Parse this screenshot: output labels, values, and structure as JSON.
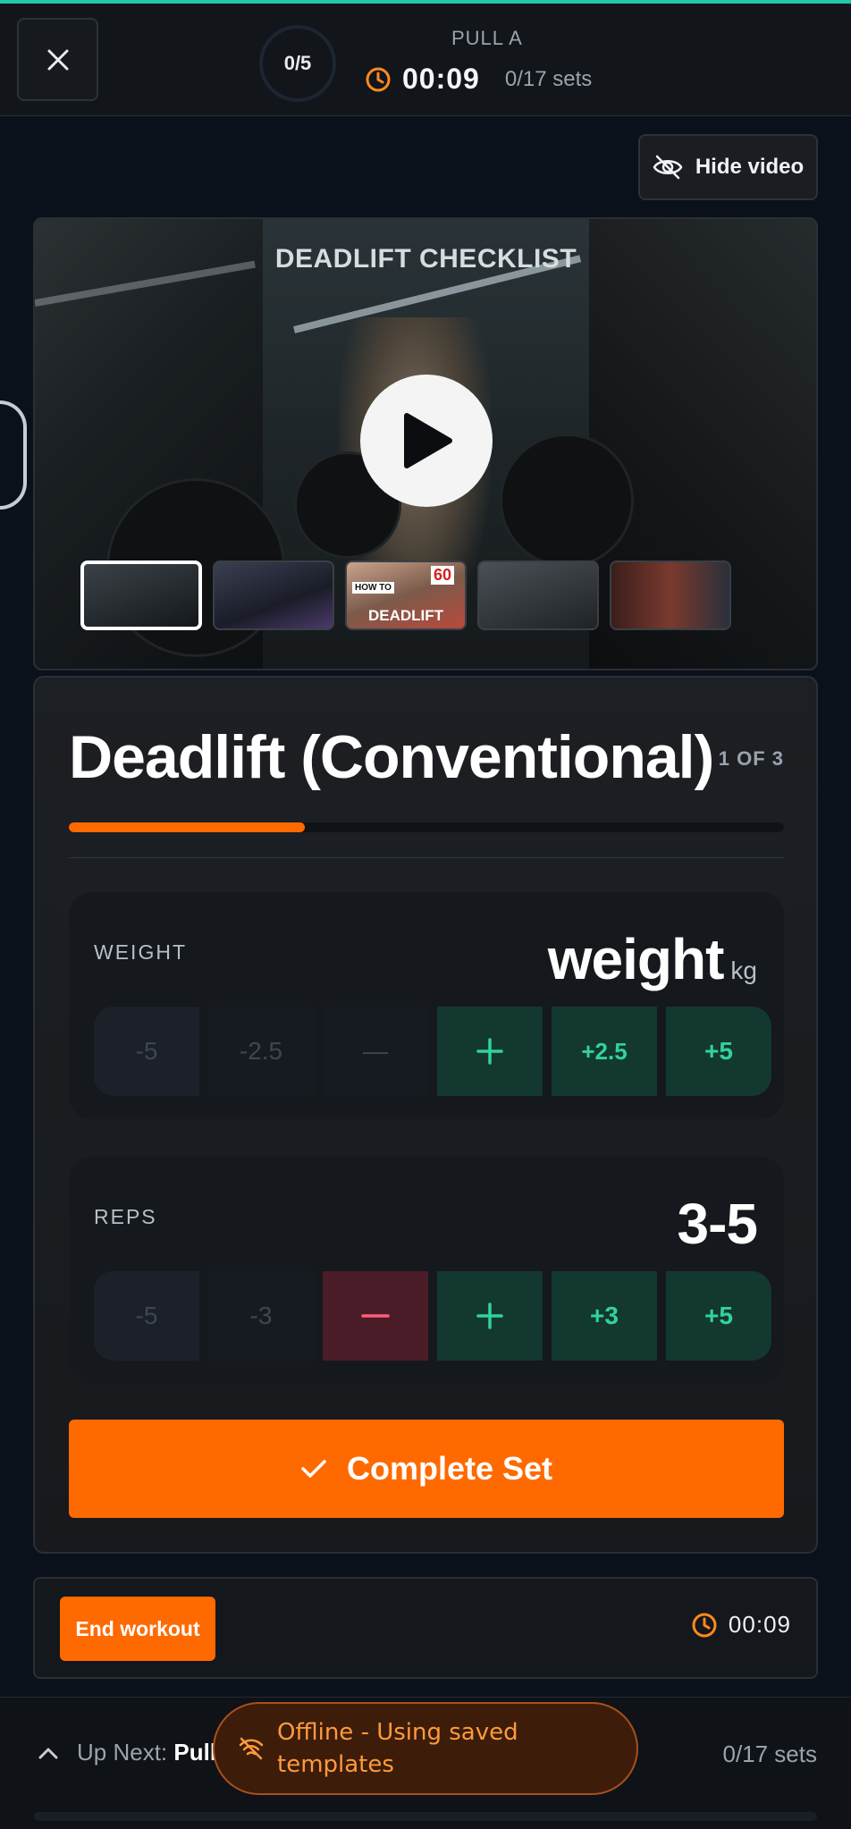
{
  "header": {
    "progress_text": "0/5",
    "workout_name": "PULL A",
    "timer": "00:09",
    "sets_progress": "0/17 sets"
  },
  "video": {
    "hide_label": "Hide video",
    "title": "DEADLIFT CHECKLIST",
    "thumbnails": [
      {
        "caption": ""
      },
      {
        "caption": ""
      },
      {
        "caption": "DEADLIFT",
        "badge": "60",
        "tag": "HOW TO"
      },
      {
        "caption": ""
      },
      {
        "caption": ""
      }
    ]
  },
  "exercise": {
    "title": "Deadlift (Conventional)",
    "count": "1 OF 3",
    "progress_fraction": 0.33,
    "weight": {
      "label": "WEIGHT",
      "value": "weight",
      "unit": "kg",
      "steps": [
        "-5",
        "-2.5",
        "—",
        "+",
        "+2.5",
        "+5"
      ]
    },
    "reps": {
      "label": "REPS",
      "value": "3-5",
      "steps": [
        "-5",
        "-3",
        "—",
        "+",
        "+3",
        "+5"
      ]
    },
    "complete_label": "Complete Set"
  },
  "footer": {
    "end_label": "End workout",
    "timer": "00:09"
  },
  "up_next": {
    "label": "Up Next:",
    "name": "Pull-",
    "sets": "0/17 sets"
  },
  "toast": {
    "text_line1": "Offline - Using saved",
    "text_line2": "templates"
  },
  "colors": {
    "accent": "#ff6a00",
    "positive": "#31d29b",
    "topline": "#21c7a8"
  }
}
